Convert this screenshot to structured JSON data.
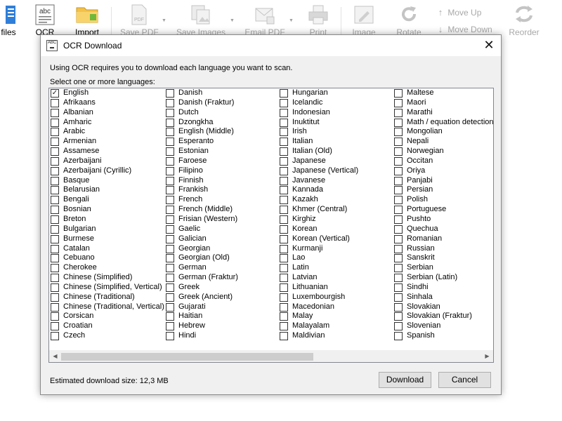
{
  "toolbar": {
    "files_label": "files",
    "ocr_label": "OCR",
    "import_label": "Import",
    "save_pdf_label": "Save PDF",
    "save_images_label": "Save Images",
    "email_pdf_label": "Email PDF",
    "print_label": "Print",
    "image_label": "Image",
    "rotate_label": "Rotate",
    "move_up_label": "Move Up",
    "move_down_label": "Move Down",
    "reorder_label": "Reorder",
    "ocr_icon_text": "abc",
    "save_pdf_icon_text": "PDF",
    "dialog_icon_text": "ABC"
  },
  "dialog": {
    "title": "OCR Download",
    "close_glyph": "✕",
    "intro": "Using OCR requires you to download each language you want to scan.",
    "select_label": "Select one or more languages:",
    "estimated_size": "Estimated download size: 12,3 MB",
    "download_label": "Download",
    "cancel_label": "Cancel"
  },
  "languages": {
    "columns": [
      [
        {
          "name": "English",
          "checked": true
        },
        {
          "name": "Afrikaans",
          "checked": false
        },
        {
          "name": "Albanian",
          "checked": false
        },
        {
          "name": "Amharic",
          "checked": false
        },
        {
          "name": "Arabic",
          "checked": false
        },
        {
          "name": "Armenian",
          "checked": false
        },
        {
          "name": "Assamese",
          "checked": false
        },
        {
          "name": "Azerbaijani",
          "checked": false
        },
        {
          "name": "Azerbaijani (Cyrillic)",
          "checked": false
        },
        {
          "name": "Basque",
          "checked": false
        },
        {
          "name": "Belarusian",
          "checked": false
        },
        {
          "name": "Bengali",
          "checked": false
        },
        {
          "name": "Bosnian",
          "checked": false
        },
        {
          "name": "Breton",
          "checked": false
        },
        {
          "name": "Bulgarian",
          "checked": false
        },
        {
          "name": "Burmese",
          "checked": false
        },
        {
          "name": "Catalan",
          "checked": false
        },
        {
          "name": "Cebuano",
          "checked": false
        },
        {
          "name": "Cherokee",
          "checked": false
        },
        {
          "name": "Chinese (Simplified)",
          "checked": false
        },
        {
          "name": "Chinese (Simplified, Vertical)",
          "checked": false
        },
        {
          "name": "Chinese (Traditional)",
          "checked": false
        },
        {
          "name": "Chinese (Traditional, Vertical)",
          "checked": false
        },
        {
          "name": "Corsican",
          "checked": false
        },
        {
          "name": "Croatian",
          "checked": false
        },
        {
          "name": "Czech",
          "checked": false
        }
      ],
      [
        {
          "name": "Danish",
          "checked": false
        },
        {
          "name": "Danish (Fraktur)",
          "checked": false
        },
        {
          "name": "Dutch",
          "checked": false
        },
        {
          "name": "Dzongkha",
          "checked": false
        },
        {
          "name": "English (Middle)",
          "checked": false
        },
        {
          "name": "Esperanto",
          "checked": false
        },
        {
          "name": "Estonian",
          "checked": false
        },
        {
          "name": "Faroese",
          "checked": false
        },
        {
          "name": "Filipino",
          "checked": false
        },
        {
          "name": "Finnish",
          "checked": false
        },
        {
          "name": "Frankish",
          "checked": false
        },
        {
          "name": "French",
          "checked": false
        },
        {
          "name": "French (Middle)",
          "checked": false
        },
        {
          "name": "Frisian (Western)",
          "checked": false
        },
        {
          "name": "Gaelic",
          "checked": false
        },
        {
          "name": "Galician",
          "checked": false
        },
        {
          "name": "Georgian",
          "checked": false
        },
        {
          "name": "Georgian (Old)",
          "checked": false
        },
        {
          "name": "German",
          "checked": false
        },
        {
          "name": "German (Fraktur)",
          "checked": false
        },
        {
          "name": "Greek",
          "checked": false
        },
        {
          "name": "Greek (Ancient)",
          "checked": false
        },
        {
          "name": "Gujarati",
          "checked": false
        },
        {
          "name": "Haitian",
          "checked": false
        },
        {
          "name": "Hebrew",
          "checked": false
        },
        {
          "name": "Hindi",
          "checked": false
        }
      ],
      [
        {
          "name": "Hungarian",
          "checked": false
        },
        {
          "name": "Icelandic",
          "checked": false
        },
        {
          "name": "Indonesian",
          "checked": false
        },
        {
          "name": "Inuktitut",
          "checked": false
        },
        {
          "name": "Irish",
          "checked": false
        },
        {
          "name": "Italian",
          "checked": false
        },
        {
          "name": "Italian (Old)",
          "checked": false
        },
        {
          "name": "Japanese",
          "checked": false
        },
        {
          "name": "Japanese (Vertical)",
          "checked": false
        },
        {
          "name": "Javanese",
          "checked": false
        },
        {
          "name": "Kannada",
          "checked": false
        },
        {
          "name": "Kazakh",
          "checked": false
        },
        {
          "name": "Khmer (Central)",
          "checked": false
        },
        {
          "name": "Kirghiz",
          "checked": false
        },
        {
          "name": "Korean",
          "checked": false
        },
        {
          "name": "Korean (Vertical)",
          "checked": false
        },
        {
          "name": "Kurmanji",
          "checked": false
        },
        {
          "name": "Lao",
          "checked": false
        },
        {
          "name": "Latin",
          "checked": false
        },
        {
          "name": "Latvian",
          "checked": false
        },
        {
          "name": "Lithuanian",
          "checked": false
        },
        {
          "name": "Luxembourgish",
          "checked": false
        },
        {
          "name": "Macedonian",
          "checked": false
        },
        {
          "name": "Malay",
          "checked": false
        },
        {
          "name": "Malayalam",
          "checked": false
        },
        {
          "name": "Maldivian",
          "checked": false
        }
      ],
      [
        {
          "name": "Maltese",
          "checked": false
        },
        {
          "name": "Maori",
          "checked": false
        },
        {
          "name": "Marathi",
          "checked": false
        },
        {
          "name": "Math / equation detection",
          "checked": false
        },
        {
          "name": "Mongolian",
          "checked": false
        },
        {
          "name": "Nepali",
          "checked": false
        },
        {
          "name": "Norwegian",
          "checked": false
        },
        {
          "name": "Occitan",
          "checked": false
        },
        {
          "name": "Oriya",
          "checked": false
        },
        {
          "name": "Panjabi",
          "checked": false
        },
        {
          "name": "Persian",
          "checked": false
        },
        {
          "name": "Polish",
          "checked": false
        },
        {
          "name": "Portuguese",
          "checked": false
        },
        {
          "name": "Pushto",
          "checked": false
        },
        {
          "name": "Quechua",
          "checked": false
        },
        {
          "name": "Romanian",
          "checked": false
        },
        {
          "name": "Russian",
          "checked": false
        },
        {
          "name": "Sanskrit",
          "checked": false
        },
        {
          "name": "Serbian",
          "checked": false
        },
        {
          "name": "Serbian (Latin)",
          "checked": false
        },
        {
          "name": "Sindhi",
          "checked": false
        },
        {
          "name": "Sinhala",
          "checked": false
        },
        {
          "name": "Slovakian",
          "checked": false
        },
        {
          "name": "Slovakian (Fraktur)",
          "checked": false
        },
        {
          "name": "Slovenian",
          "checked": false
        },
        {
          "name": "Spanish",
          "checked": false
        }
      ]
    ]
  },
  "scrollbar": {
    "left_glyph": "◀",
    "right_glyph": "▶"
  },
  "colors": {
    "dialog_bg": "#f0f0f0",
    "list_bg": "#ffffff",
    "disabled_text": "#a9a9a9",
    "button_bg": "#e1e1e1"
  }
}
